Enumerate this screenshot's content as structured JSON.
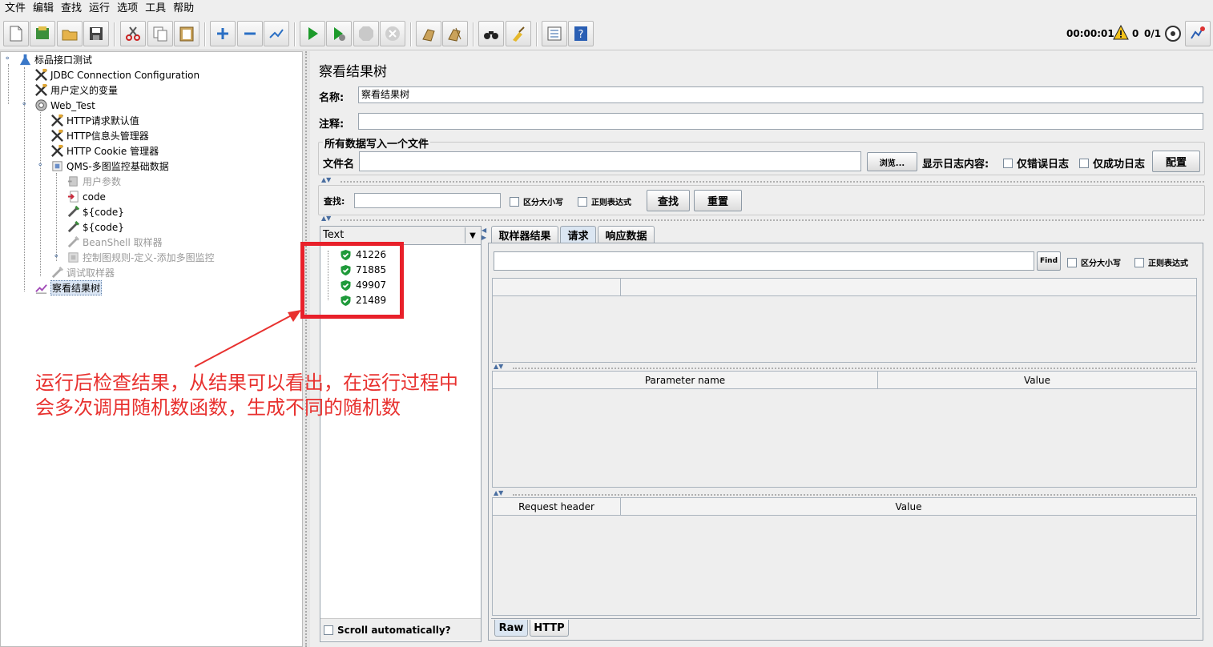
{
  "menu": [
    "文件",
    "编辑",
    "查找",
    "运行",
    "选项",
    "工具",
    "帮助"
  ],
  "toolbar": {
    "buttons": [
      "new-icon",
      "templates-icon",
      "open-icon",
      "save-icon",
      "cut-icon",
      "copy-icon",
      "paste-icon",
      "expand-icon",
      "collapse-icon",
      "toggle-icon",
      "start-icon",
      "start-no-pause-icon",
      "stop-icon",
      "shutdown-icon",
      "clear-icon",
      "clear-all-icon",
      "search-icon",
      "reset-search-icon",
      "function-helper-icon",
      "help-icon"
    ],
    "timer": "00:00:01",
    "warnings": "0",
    "threads": "0/1"
  },
  "tree": {
    "items": [
      {
        "label": "标品接口测试",
        "icon": "test-plan-icon"
      },
      {
        "label": "JDBC Connection Configuration",
        "icon": "config-icon"
      },
      {
        "label": "用户定义的变量",
        "icon": "config-icon"
      },
      {
        "label": "Web_Test",
        "icon": "thread-group-icon"
      },
      {
        "label": "HTTP请求默认值",
        "icon": "config-icon"
      },
      {
        "label": "HTTP信息头管理器",
        "icon": "config-icon"
      },
      {
        "label": "HTTP Cookie 管理器",
        "icon": "config-icon"
      },
      {
        "label": "QMS-多图监控基础数据",
        "icon": "controller-icon"
      },
      {
        "label": "用户参数",
        "icon": "preprocessor-icon"
      },
      {
        "label": "code",
        "icon": "sampler-icon"
      },
      {
        "label": "${code}",
        "icon": "pipette-icon"
      },
      {
        "label": "${code}",
        "icon": "pipette-icon"
      },
      {
        "label": "BeanShell 取样器",
        "icon": "pipette-icon"
      },
      {
        "label": "控制图规则-定义-添加多图监控",
        "icon": "controller-icon"
      },
      {
        "label": "调试取样器",
        "icon": "pipette-icon"
      },
      {
        "label": "察看结果树",
        "icon": "listener-icon"
      }
    ]
  },
  "panel": {
    "title": "察看结果树",
    "name_label": "名称:",
    "name_value": "察看结果树",
    "comment_label": "注释:",
    "comment_value": "",
    "file_group_title": "所有数据写入一个文件",
    "filename_label": "文件名",
    "filename_value": "",
    "browse_button": "浏览...",
    "log_label": "显示日志内容:",
    "errors_only": "仅错误日志",
    "success_only": "仅成功日志",
    "configure_button": "配置",
    "search_label": "查找:",
    "search_value": "",
    "case_sensitive": "区分大小写",
    "regex": "正则表达式",
    "find_button": "查找",
    "reset_button": "重置"
  },
  "results": {
    "renderer": "Text",
    "samples": [
      "41226",
      "71885",
      "49907",
      "21489"
    ],
    "scroll_auto": "Scroll automatically?"
  },
  "detail": {
    "tabs": [
      "取样器结果",
      "请求",
      "响应数据"
    ],
    "active_tab": "请求",
    "find_button": "Find",
    "case_sensitive": "区分大小写",
    "regex": "正则表达式",
    "params_headers": [
      "Parameter name",
      "Value"
    ],
    "request_headers": [
      "Request header",
      "Value"
    ],
    "bottom_tabs": [
      "Raw",
      "HTTP"
    ]
  },
  "annotation": {
    "line1": "运行后检查结果，从结果可以看出，在运行过程中",
    "line2": "会多次调用随机数函数，生成不同的随机数",
    "color": "#e8312f"
  }
}
